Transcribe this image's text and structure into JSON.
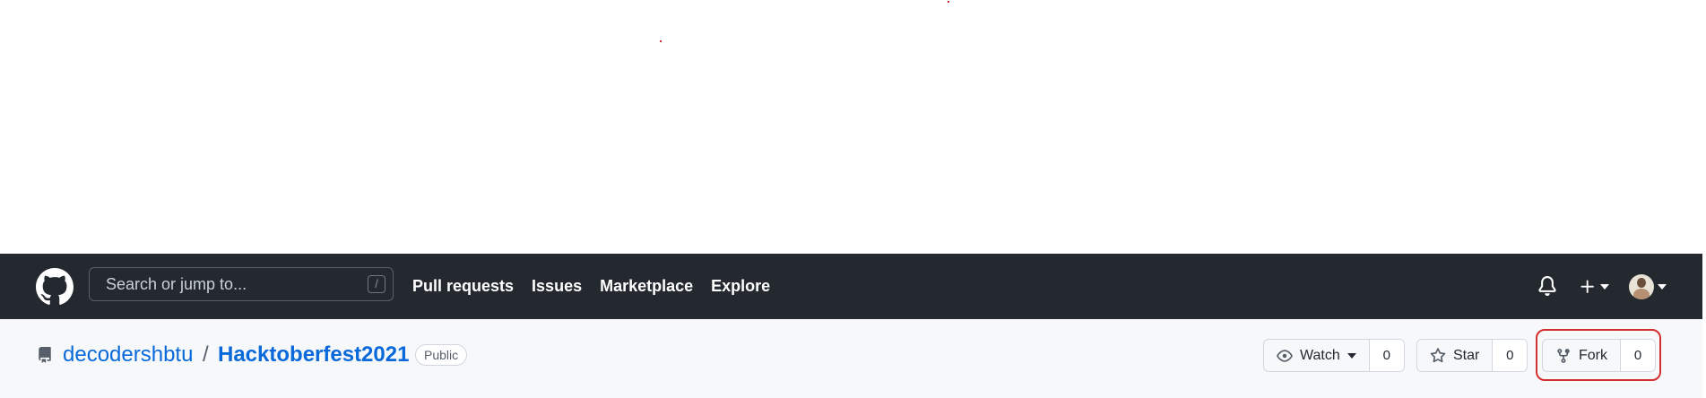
{
  "header": {
    "logo": "github-mark-icon",
    "search": {
      "placeholder": "Search or jump to...",
      "shortcut": "/"
    },
    "nav": [
      "Pull requests",
      "Issues",
      "Marketplace",
      "Explore"
    ],
    "right_icons": [
      "bell-icon",
      "plus-icon",
      "avatar"
    ]
  },
  "repo": {
    "owner": "decodershbtu",
    "separator": "/",
    "name": "Hacktoberfest2021",
    "visibility": "Public",
    "actions": {
      "watch": {
        "label": "Watch",
        "count": "0"
      },
      "star": {
        "label": "Star",
        "count": "0"
      },
      "fork": {
        "label": "Fork",
        "count": "0"
      }
    }
  },
  "colors": {
    "header_bg": "#24292f",
    "repo_bar_bg": "#f6f8fa",
    "link": "#0969da",
    "annotation": "#d32f2f"
  }
}
